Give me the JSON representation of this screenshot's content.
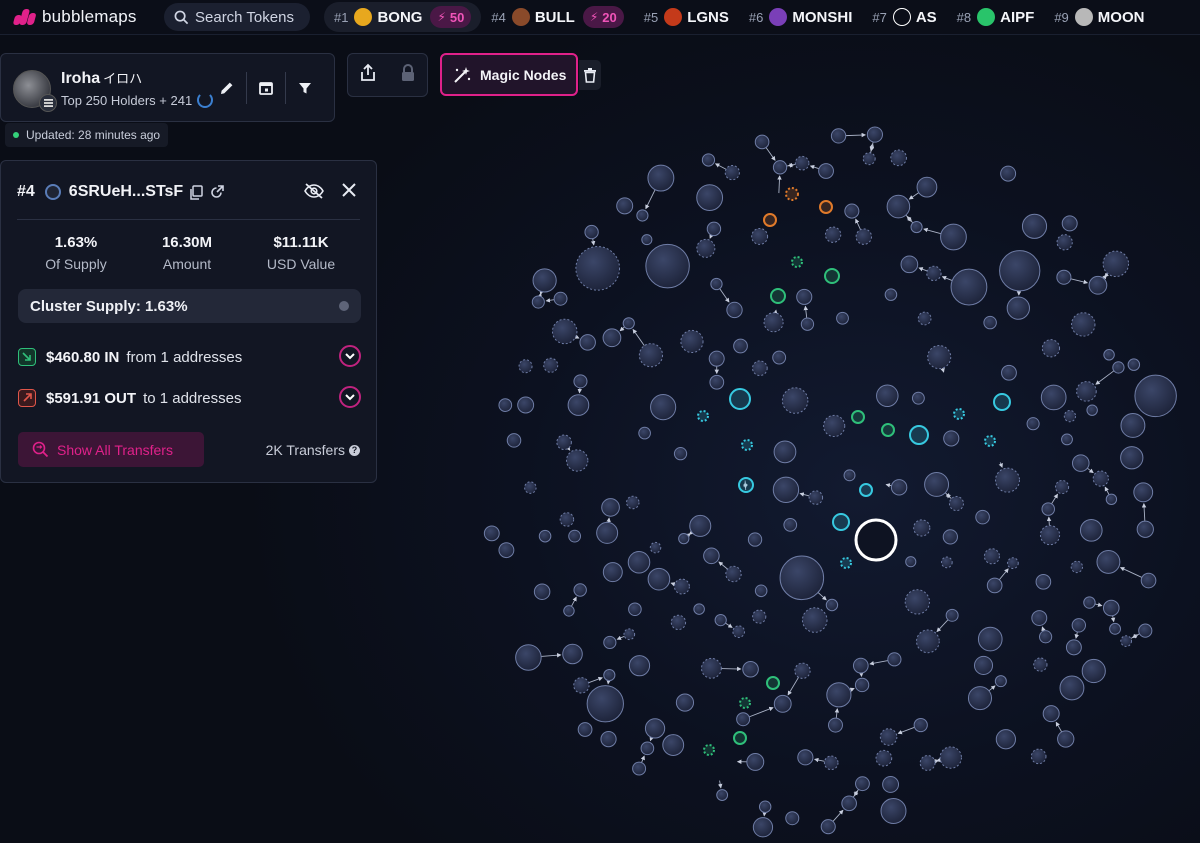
{
  "brand": {
    "name": "bubblemaps"
  },
  "search": {
    "placeholder": "Search Tokens"
  },
  "ranking": [
    {
      "rank": "#1",
      "symbol": "BONG",
      "boost": "50",
      "icon": "bong-token-icon",
      "color": "#e8a81e"
    },
    {
      "rank": "#4",
      "symbol": "BULL",
      "boost": "20",
      "icon": "bull-token-icon",
      "color": "#8a4a2a"
    },
    {
      "rank": "#5",
      "symbol": "LGNS",
      "icon": "lgns-token-icon",
      "color": "#c43a1a"
    },
    {
      "rank": "#6",
      "symbol": "MONSHI",
      "icon": "monshi-token-icon",
      "color": "#7a3fb8"
    },
    {
      "rank": "#7",
      "symbol": "AS",
      "icon": "as-token-icon",
      "color": "#ffffff"
    },
    {
      "rank": "#8",
      "symbol": "AIPF",
      "icon": "aipf-token-icon",
      "color": "#29c46a"
    },
    {
      "rank": "#9",
      "symbol": "MOON",
      "icon": "moon-token-icon",
      "color": "#b8b8b8"
    }
  ],
  "token": {
    "name": "Iroha",
    "name_jp": "イロハ",
    "holders": "Top 250 Holders + 241"
  },
  "updated": "Updated: 28 minutes ago",
  "magic_nodes": "Magic Nodes",
  "detail": {
    "rank": "#4",
    "address": "6SRUeH...STsF",
    "stats": [
      {
        "value": "1.63%",
        "label": "Of Supply"
      },
      {
        "value": "16.30M",
        "label": "Amount"
      },
      {
        "value": "$11.11K",
        "label": "USD Value"
      }
    ],
    "cluster_supply": "Cluster Supply: 1.63%",
    "in": {
      "amount": "$460.80 IN",
      "text": "from 1 addresses"
    },
    "out": {
      "amount": "$591.91 OUT",
      "text": "to 1 addresses"
    },
    "show_all": "Show All Transfers",
    "transfers": "2K Transfers"
  },
  "colors": {
    "accent": "#e0218a",
    "in": "#2fbf7a",
    "out": "#e0564a",
    "cyan": "#37c9e0",
    "orange": "#e07a2a"
  }
}
